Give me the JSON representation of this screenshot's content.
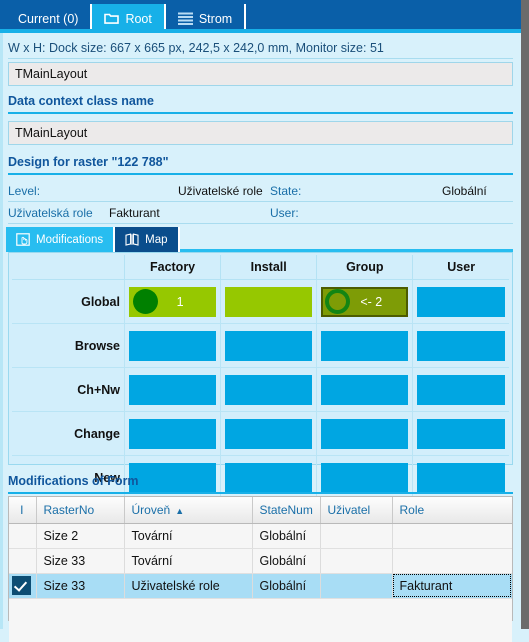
{
  "window": {
    "top_tabs": [
      {
        "label": "Current (0)",
        "icon": "",
        "active": false
      },
      {
        "label": "Root",
        "icon": "folder-icon",
        "active": true
      },
      {
        "label": "Strom",
        "icon": "list-icon",
        "active": false
      }
    ]
  },
  "info": {
    "dock_line": "W x H: Dock size: 667 x 665 px, 242,5 x 242,0 mm, Monitor size: 51"
  },
  "fields": {
    "layout_name": "TMainLayout",
    "data_context_header": "Data context class name",
    "data_context_value": "TMainLayout",
    "design_header": "Design for raster \"122 788\""
  },
  "meta": {
    "level_label": "Level:",
    "level_value": "Uživatelské role",
    "state_label": "State:",
    "state_value": "Globální",
    "role_label": "Uživatelská role",
    "role_value": "Fakturant",
    "user_label": "User:",
    "user_value": ""
  },
  "inner_tabs": [
    {
      "label": "Modifications",
      "icon": "hand-pointer-icon",
      "active": true
    },
    {
      "label": "Map",
      "icon": "map-icon",
      "active": false
    }
  ],
  "matrix": {
    "columns": [
      "Factory",
      "Install",
      "Group",
      "User"
    ],
    "rows": [
      {
        "label": "Global",
        "cells": [
          {
            "style": "green",
            "marker": "dot",
            "text": "1"
          },
          {
            "style": "green",
            "marker": "none",
            "text": ""
          },
          {
            "style": "olive",
            "marker": "ring",
            "text": "<- 2"
          },
          {
            "style": "blue",
            "marker": "none",
            "text": ""
          }
        ]
      },
      {
        "label": "Browse",
        "cells": [
          {
            "style": "blue",
            "marker": "none",
            "text": ""
          },
          {
            "style": "blue",
            "marker": "none",
            "text": ""
          },
          {
            "style": "blue",
            "marker": "none",
            "text": ""
          },
          {
            "style": "blue",
            "marker": "none",
            "text": ""
          }
        ]
      },
      {
        "label": "Ch+Nw",
        "cells": [
          {
            "style": "blue",
            "marker": "none",
            "text": ""
          },
          {
            "style": "blue",
            "marker": "none",
            "text": ""
          },
          {
            "style": "blue",
            "marker": "none",
            "text": ""
          },
          {
            "style": "blue",
            "marker": "none",
            "text": ""
          }
        ]
      },
      {
        "label": "Change",
        "cells": [
          {
            "style": "blue",
            "marker": "none",
            "text": ""
          },
          {
            "style": "blue",
            "marker": "none",
            "text": ""
          },
          {
            "style": "blue",
            "marker": "none",
            "text": ""
          },
          {
            "style": "blue",
            "marker": "none",
            "text": ""
          }
        ]
      },
      {
        "label": "New",
        "cells": [
          {
            "style": "blue",
            "marker": "none",
            "text": ""
          },
          {
            "style": "blue",
            "marker": "none",
            "text": ""
          },
          {
            "style": "blue",
            "marker": "none",
            "text": ""
          },
          {
            "style": "blue",
            "marker": "none",
            "text": ""
          }
        ]
      }
    ]
  },
  "grid": {
    "title": "Modifications of Form",
    "columns": [
      {
        "key": "chk",
        "label": "I"
      },
      {
        "key": "rasterno",
        "label": "RasterNo"
      },
      {
        "key": "uroven",
        "label": "Úroveň",
        "sort": "▲"
      },
      {
        "key": "statenum",
        "label": "StateNum"
      },
      {
        "key": "uzivatel",
        "label": "Uživatel"
      },
      {
        "key": "role",
        "label": "Role"
      }
    ],
    "rows": [
      {
        "checked": false,
        "selected": false,
        "rasterno": "Size 2",
        "uroven": "Tovární",
        "statenum": "Globální",
        "uzivatel": "",
        "role": ""
      },
      {
        "checked": false,
        "selected": false,
        "rasterno": "Size 33",
        "uroven": "Tovární",
        "statenum": "Globální",
        "uzivatel": "",
        "role": ""
      },
      {
        "checked": true,
        "selected": true,
        "rasterno": "Size 33",
        "uroven": "Uživatelské role",
        "statenum": "Globální",
        "uzivatel": "",
        "role": "Fakturant"
      }
    ]
  },
  "colors": {
    "tabbar": "#0a5fa8",
    "accent": "#17b0e8",
    "panel_bg": "#d8f1fb",
    "cell_blue": "#00a6e2",
    "cell_green": "#96c800",
    "cell_olive": "#7e9c06",
    "marker_green": "#008000",
    "header_text": "#10569c",
    "selection": "#a8ddf5"
  }
}
